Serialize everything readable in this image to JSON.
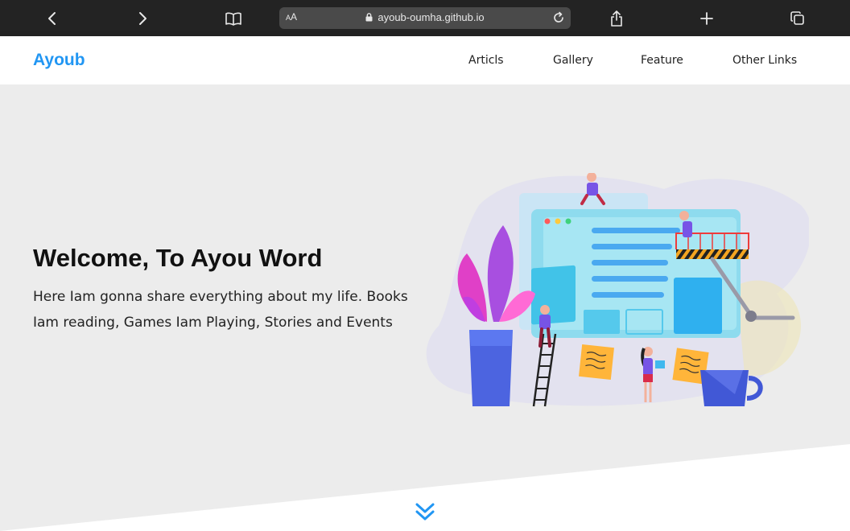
{
  "browser": {
    "aa_label_small": "A",
    "aa_label_big": "A",
    "url": "ayoub-oumha.github.io"
  },
  "site": {
    "logo": "Ayoub",
    "nav": [
      "Articls",
      "Gallery",
      "Feature",
      "Other Links"
    ]
  },
  "hero": {
    "title": "Welcome, To Ayou Word",
    "description": "Here Iam gonna share everything about my life. Books Iam reading, Games Iam Playing, Stories and Events"
  },
  "colors": {
    "accent": "#2196f3",
    "chrome": "#232323",
    "hero_bg": "#ececec"
  },
  "icons": [
    "back-icon",
    "forward-icon",
    "bookmarks-icon",
    "lock-icon",
    "reload-icon",
    "share-icon",
    "new-tab-icon",
    "tabs-icon",
    "scroll-down-icon"
  ]
}
